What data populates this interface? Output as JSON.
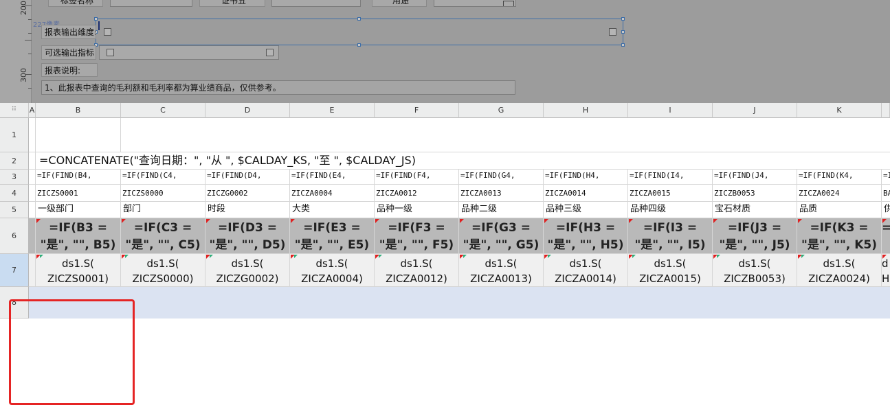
{
  "designer": {
    "ruler_labels": [
      "200",
      "300"
    ],
    "pixel_label": "227像素",
    "top_labels": [
      "标签名称",
      "证书五",
      "用途"
    ],
    "params": [
      {
        "label": "报表输出维度:"
      },
      {
        "label": "可选输出指标"
      }
    ],
    "desc_label": "报表说明:",
    "desc_text": "1、此报表中查询的毛利额和毛利率都为算业绩商品，仅供参考。"
  },
  "grid": {
    "columns": [
      "A",
      "B",
      "C",
      "D",
      "E",
      "F",
      "G",
      "H",
      "I",
      "J",
      "K"
    ],
    "rows": [
      "1",
      "2",
      "3",
      "4",
      "5",
      "6",
      "7",
      "8"
    ],
    "row2_formula": "=CONCATENATE(\"查询日期：\", \"从 \", $CALDAY_KS, \"至 \", $CALDAY_JS)",
    "row3": [
      "=IF(FIND(B4,",
      "=IF(FIND(C4,",
      "=IF(FIND(D4,",
      "=IF(FIND(E4,",
      "=IF(FIND(F4,",
      "=IF(FIND(G4,",
      "=IF(FIND(H4,",
      "=IF(FIND(I4,",
      "=IF(FIND(J4,",
      "=IF(FIND(K4,",
      "=I"
    ],
    "row4": [
      "ZICZS0001",
      "ZICZS0000",
      "ZICZG0002",
      "ZICZA0004",
      "ZICZA0012",
      "ZICZA0013",
      "ZICZA0014",
      "ZICZA0015",
      "ZICZB0053",
      "ZICZA0024",
      "BA"
    ],
    "row5": [
      "一级部门",
      "部门",
      "时段",
      "大类",
      "品种一级",
      "品种二级",
      "品种三级",
      "品种四级",
      "宝石材质",
      "品质",
      "供"
    ],
    "row6": [
      "=IF(B3 = \"是\", \"\", B5)",
      "=IF(C3 = \"是\", \"\", C5)",
      "=IF(D3 = \"是\", \"\", D5)",
      "=IF(E3 = \"是\", \"\", E5)",
      "=IF(F3 = \"是\", \"\", F5)",
      "=IF(G3 = \"是\", \"\", G5)",
      "=IF(H3 = \"是\", \"\", H5)",
      "=IF(I3 = \"是\", \"\", I5)",
      "=IF(J3 = \"是\", \"\", J5)",
      "=IF(K3 = \"是\", \"\", K5)",
      "="
    ],
    "row7": [
      "ds1.S( ZICZS0001)",
      "ds1.S( ZICZS0000)",
      "ds1.S( ZICZG0002)",
      "ds1.S( ZICZA0004)",
      "ds1.S( ZICZA0012)",
      "ds1.S( ZICZA0013)",
      "ds1.S( ZICZA0014)",
      "ds1.S( ZICZA0015)",
      "ds1.S( ZICZB0053)",
      "ds1.S( ZICZA0024)",
      "d H"
    ]
  },
  "colors": {
    "designer_bg": "#9c9c9c",
    "header_bg": "#eceded",
    "highlight_border": "#e52424",
    "selection_border": "#3d6ea8",
    "row6_bg": "#b9b9b9",
    "row7_bg": "#f0f0f0"
  }
}
